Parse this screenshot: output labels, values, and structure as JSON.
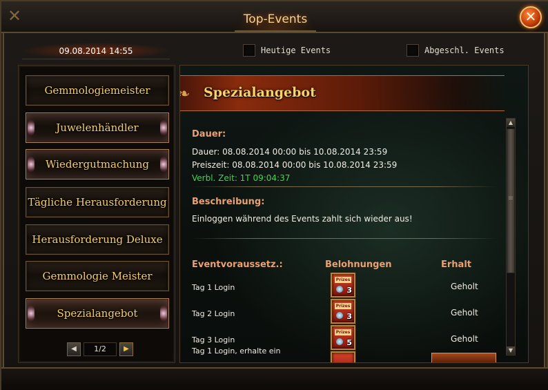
{
  "window": {
    "title": "Top-Events",
    "close_glyph": "✕"
  },
  "header": {
    "datetime": "09.08.2014 14:55",
    "filters": [
      {
        "label": "Heutige Events",
        "checked": false
      },
      {
        "label": "Abgeschl. Events",
        "checked": false
      }
    ]
  },
  "sidebar": {
    "items": [
      {
        "label": "Gemmologiemeister"
      },
      {
        "label": "Juwelenhändler"
      },
      {
        "label": "Wiedergutmachung"
      },
      {
        "label": "Tägliche Herausforderung"
      },
      {
        "label": "Herausforderung Deluxe"
      },
      {
        "label": "Gemmologie Meister"
      },
      {
        "label": "Spezialangebot"
      }
    ],
    "pager": {
      "text": "1/2",
      "prev_glyph": "◀",
      "next_glyph": "▶"
    }
  },
  "detail": {
    "title": "Spezialangebot",
    "duration_heading": "Dauer:",
    "duration_line": "Dauer: 08.08.2014 00:00 bis 10.08.2014 23:59",
    "prize_time_line": "Preiszeit: 08.08.2014 00:00 bis 10.08.2014 23:59",
    "remaining_line": "Verbl. Zeit: 1T 09:04:37",
    "description_heading": "Beschreibung:",
    "description_text": "Einloggen während des Events zahlt sich wieder aus!",
    "columns": {
      "requirement": "Eventvoraussetz.:",
      "rewards": "Belohnungen",
      "received": "Erhalt"
    },
    "rows": [
      {
        "requirement": "Tag 1 Login",
        "reward_tag": "Prizes",
        "reward_count": "3",
        "status": "Geholt"
      },
      {
        "requirement": "Tag 2 Login",
        "reward_tag": "Prizes",
        "reward_count": "3",
        "status": "Geholt"
      },
      {
        "requirement": "Tag 3 Login",
        "reward_tag": "Prizes",
        "reward_count": "5",
        "status": "Geholt"
      }
    ],
    "partial_row": "Tag 1 Login, erhalte ein"
  },
  "icons": {
    "close": "close-icon",
    "prev": "arrow-left-icon",
    "next": "arrow-right-icon",
    "scroll_up": "scroll-up-icon",
    "scroll_down": "scroll-down-icon",
    "reward": "prize-chest-icon"
  },
  "colors": {
    "title_gold": "#f2d59a",
    "nav_gold": "#f2cf6b",
    "heading_orange": "#e9a171",
    "remaining_green": "#41d64a",
    "banner_red": "#8a2b0d"
  }
}
